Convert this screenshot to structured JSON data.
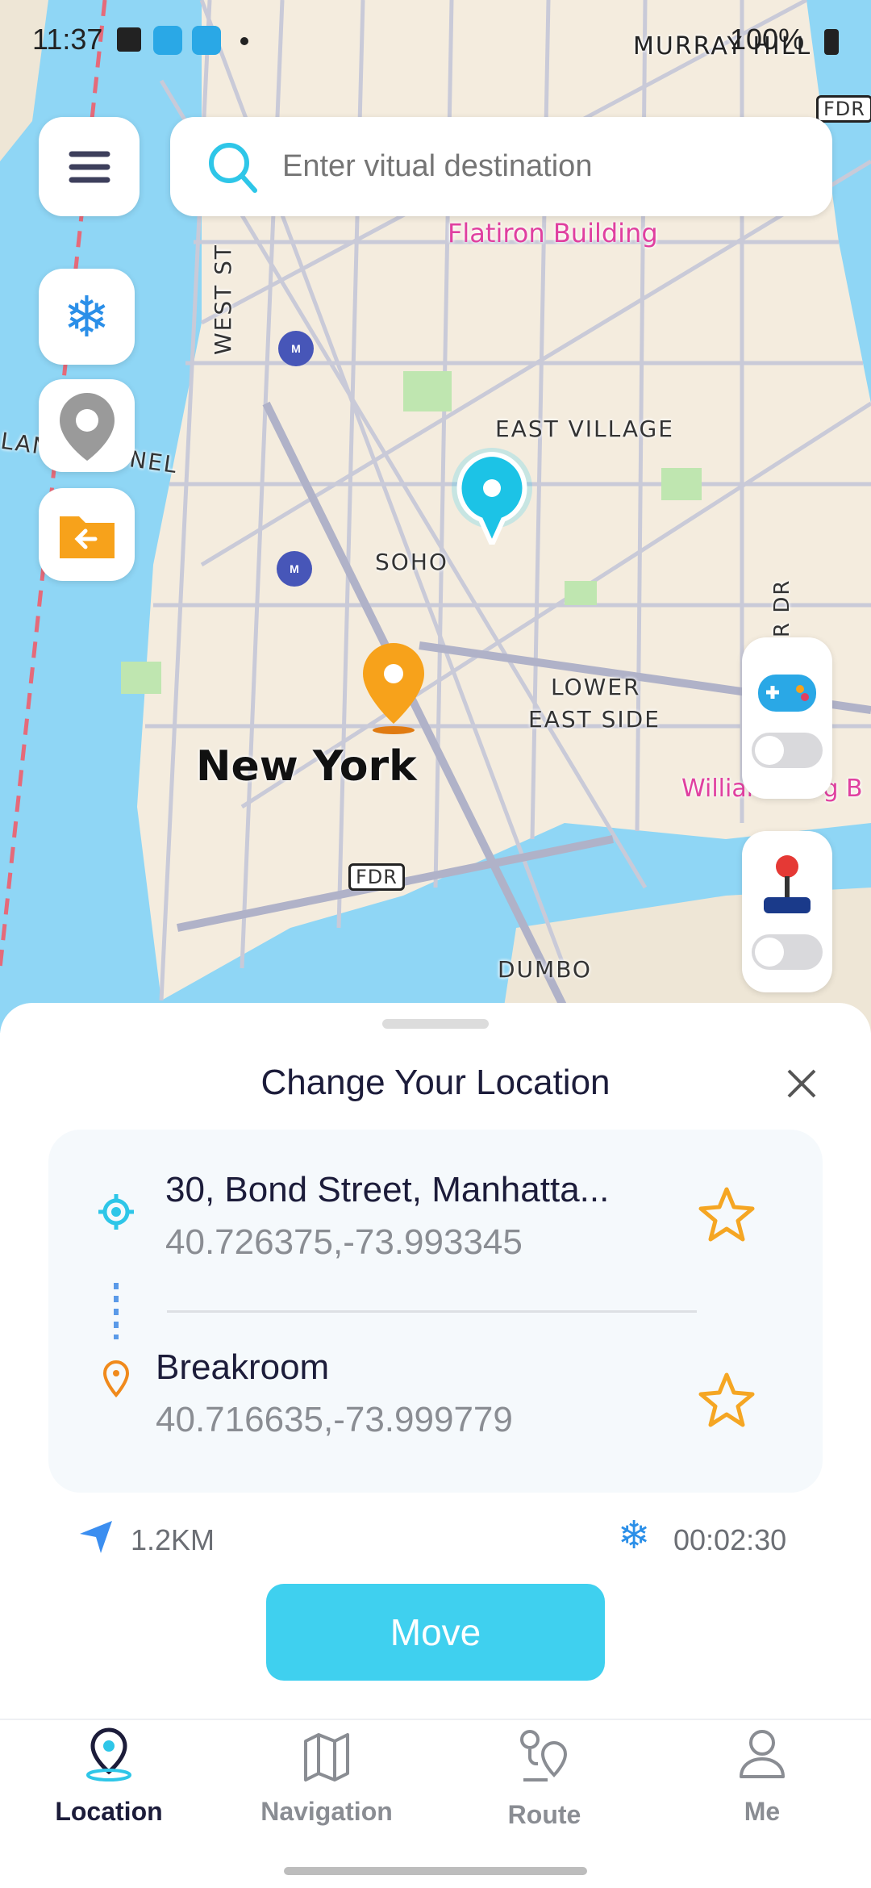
{
  "status_bar": {
    "time": "11:37",
    "battery": "100%"
  },
  "search": {
    "placeholder": "Enter vitual destination"
  },
  "map": {
    "labels": {
      "flatiron": "Flatiron Building",
      "east_village": "EAST VILLAGE",
      "soho": "SOHO",
      "lower_east_side_1": "LOWER",
      "lower_east_side_2": "EAST SIDE",
      "new_york": "New York",
      "dumbo": "DUMBO",
      "west_st": "WEST ST",
      "tunnel": "LAND TUNNEL",
      "fdr": "FDR",
      "fdr_top": "FDR",
      "murray_hill": "MURRAY HILL",
      "williamsburg": "Williamsburg B",
      "fdr_dr": "R DR"
    }
  },
  "sheet": {
    "title": "Change Your Location",
    "from": {
      "name": "30, Bond Street, Manhatta...",
      "coords": "40.726375,-73.993345"
    },
    "to": {
      "name": "Breakroom",
      "coords": "40.716635,-73.999779"
    },
    "distance": "1.2KM",
    "duration": "00:02:30",
    "move_label": "Move"
  },
  "toggles": {
    "game_mode": false,
    "joystick": false
  },
  "tabs": [
    {
      "label": "Location",
      "active": true
    },
    {
      "label": "Navigation"
    },
    {
      "label": "Route"
    },
    {
      "label": "Me"
    }
  ],
  "colors": {
    "accent": "#3fd0ef",
    "star": "#f5a623",
    "active_tab": "#1c1c3a"
  }
}
